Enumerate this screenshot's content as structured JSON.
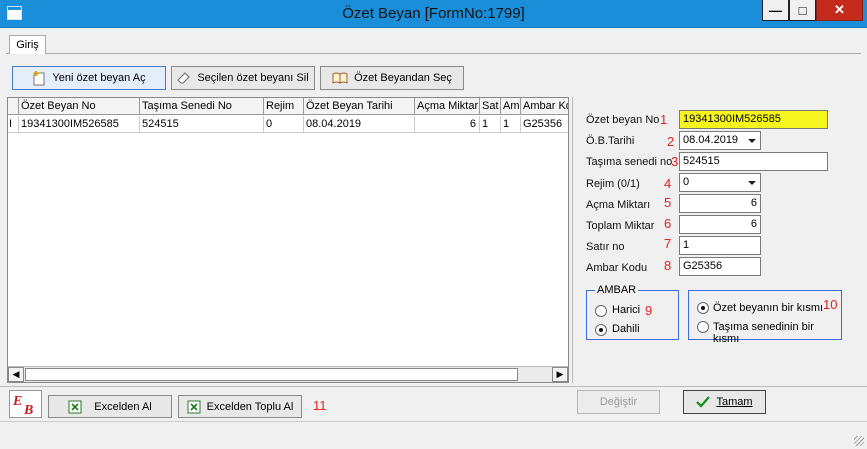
{
  "window": {
    "title": "Özet Beyan [FormNo:1799]"
  },
  "window_controls": {
    "minimize": "—",
    "maximize": "□",
    "close": "✕"
  },
  "tabs": [
    {
      "label": "Giriş"
    }
  ],
  "toolbar": {
    "new_label": "Yeni özet beyan Aç",
    "delete_label": "Seçilen özet beyanı Sil",
    "select_label": "Özet Beyandan Seç"
  },
  "grid": {
    "columns": [
      "Özet Beyan No",
      "Taşıma Senedi No",
      "Rejim",
      "Özet Beyan Tarihi",
      "Açma Miktar",
      "Sat",
      "Am",
      "Ambar Ko"
    ],
    "rows": [
      {
        "indicator": "I",
        "cells": [
          "19341300IM526585",
          "524515",
          "0",
          "08.04.2019",
          "6",
          "1",
          "1",
          "G25356"
        ]
      }
    ],
    "scroll_left": "◀",
    "scroll_right": "▶"
  },
  "form": {
    "ozet_beyan_no": {
      "label": "Özet beyan No",
      "value": "19341300IM526585",
      "annotation": "1"
    },
    "ob_tarihi": {
      "label": "Ö.B.Tarihi",
      "value": "08.04.2019",
      "annotation": "2"
    },
    "tasima_senedi_no": {
      "label": "Taşıma senedi no",
      "value": "524515",
      "annotation": "3"
    },
    "rejim": {
      "label": "Rejim  (0/1)",
      "value": "0",
      "annotation": "4"
    },
    "acma_miktari": {
      "label": "Açma Miktarı",
      "value": "6",
      "annotation": "5"
    },
    "toplam_miktar": {
      "label": "Toplam Miktar",
      "value": "6",
      "annotation": "6"
    },
    "satir_no": {
      "label": "Satır no",
      "value": "1",
      "annotation": "7"
    },
    "ambar_kodu": {
      "label": "Ambar Kodu",
      "value": "G25356",
      "annotation": "8"
    }
  },
  "ambar_group": {
    "title": "AMBAR",
    "options": [
      {
        "label": "Harici",
        "selected": false
      },
      {
        "label": "Dahili",
        "selected": true
      }
    ],
    "annotation": "9"
  },
  "scope_group": {
    "options": [
      {
        "label": "Özet beyanın bir kısmı",
        "selected": true
      },
      {
        "label": "Taşıma senedinin bir kısmı",
        "selected": false
      }
    ],
    "annotation": "10"
  },
  "bottom": {
    "excel_label": "Excelden Al",
    "excel_bulk_label": "Excelden Toplu Al",
    "excel_annotation": "11",
    "degistir_label": "Değiştir",
    "tamam_label": "Tamam"
  },
  "colors": {
    "title_bar": "#1a8ed8",
    "close_button": "#c42b1c",
    "highlight_field": "#f6f61e",
    "annotation_red": "#e02020",
    "group_border": "#3a6ee0",
    "ok_check": "#1a8a1a"
  },
  "icons": {
    "app": "window-icon",
    "new": "new-document-icon",
    "delete": "eraser-icon",
    "select": "book-icon",
    "excel": "excel-icon",
    "ok": "checkmark-icon",
    "logo": "eb-logo-icon"
  }
}
